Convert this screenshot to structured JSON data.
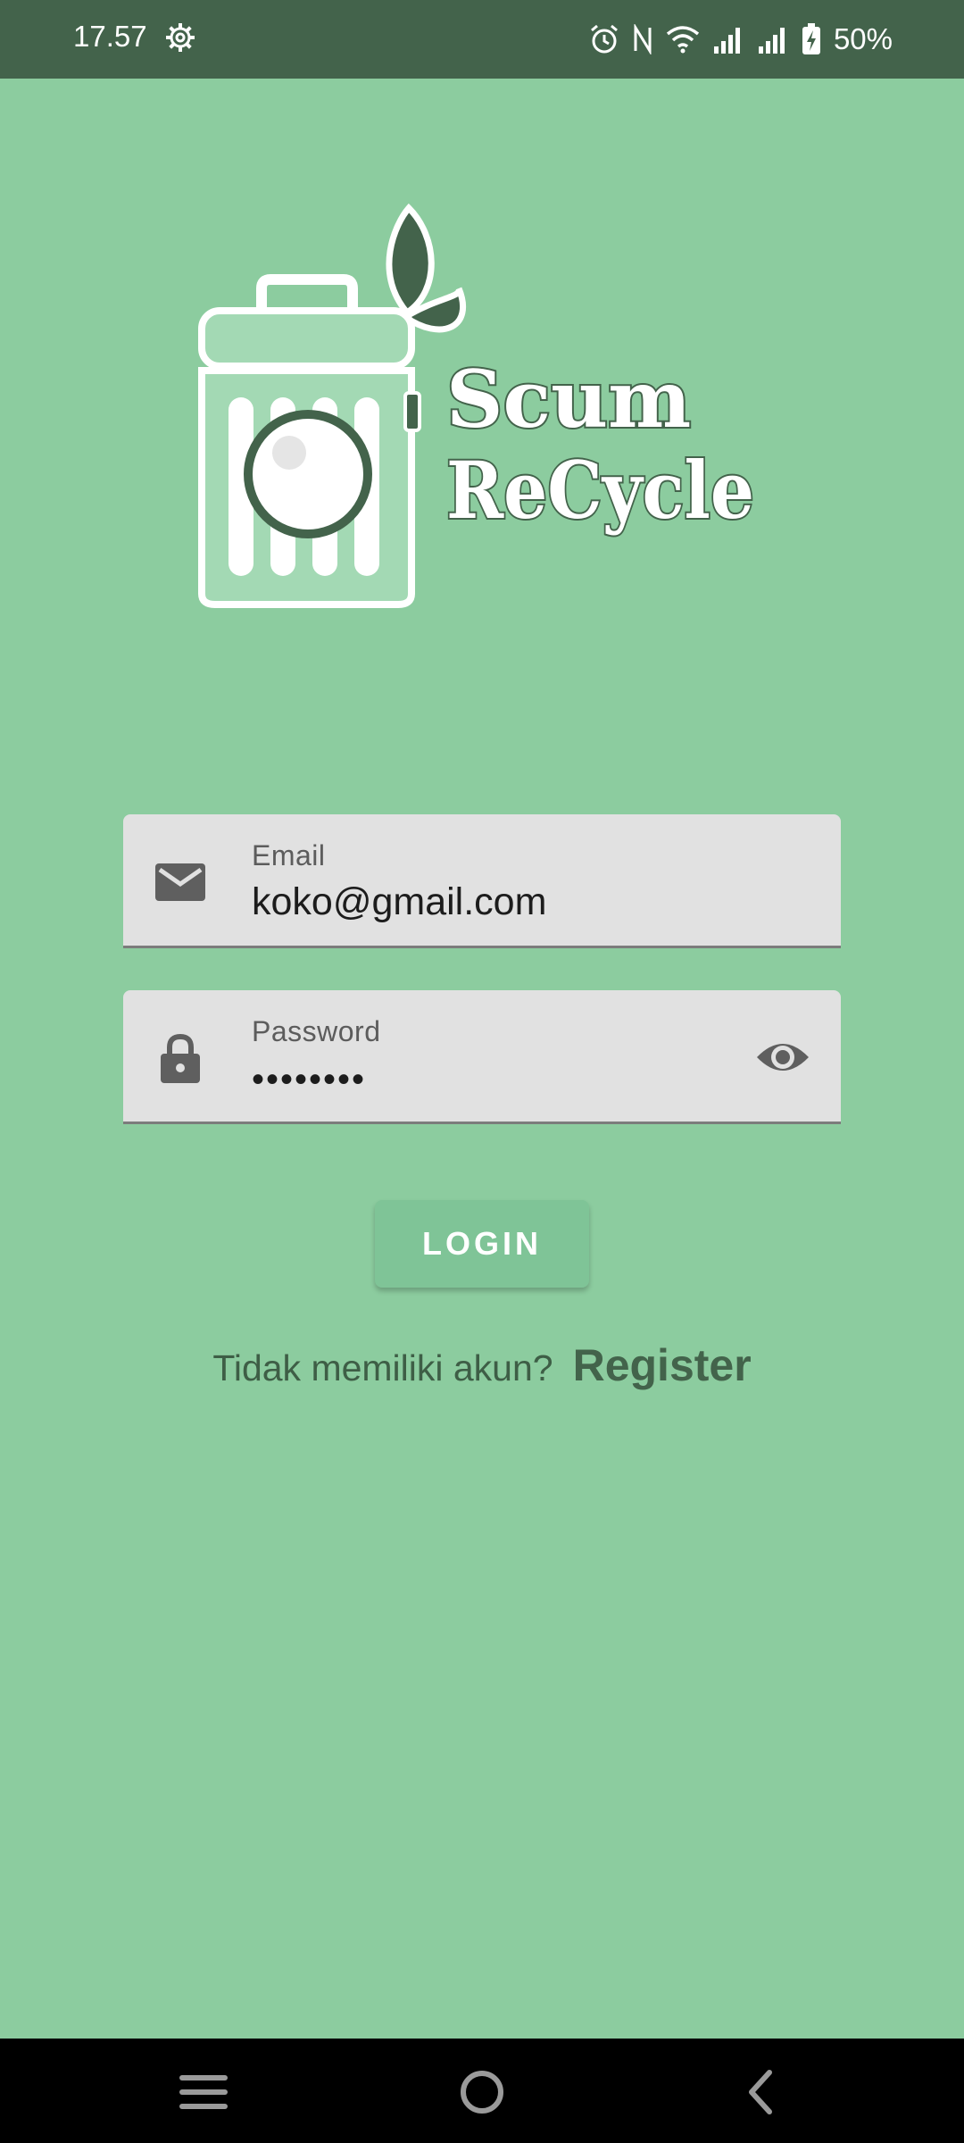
{
  "status_bar": {
    "time": "17.57",
    "battery": "50%",
    "icons": [
      "gear-icon",
      "alarm-icon",
      "nfc-icon",
      "wifi-icon",
      "signal-icon",
      "signal-icon",
      "battery-charging-icon"
    ]
  },
  "logo": {
    "line1": "Scum",
    "line2": "ReCycle",
    "icon": "recycle-bin-logo"
  },
  "form": {
    "email": {
      "label": "Email",
      "value": "koko@gmail.com",
      "icon": "mail-icon"
    },
    "password": {
      "label": "Password",
      "value": "••••••••",
      "icon": "lock-icon",
      "toggle_icon": "eye-icon"
    },
    "login_label": "LOGIN",
    "register_prompt": "Tidak memiliki akun?",
    "register_label": "Register"
  },
  "nav_bar": {
    "icons": [
      "menu-icon",
      "home-icon",
      "back-icon"
    ]
  },
  "colors": {
    "background": "#8ccc9f",
    "status_bar": "#43634b",
    "field": "#e1e1e1",
    "button": "#7fc497",
    "accent_dark": "#43634b"
  }
}
